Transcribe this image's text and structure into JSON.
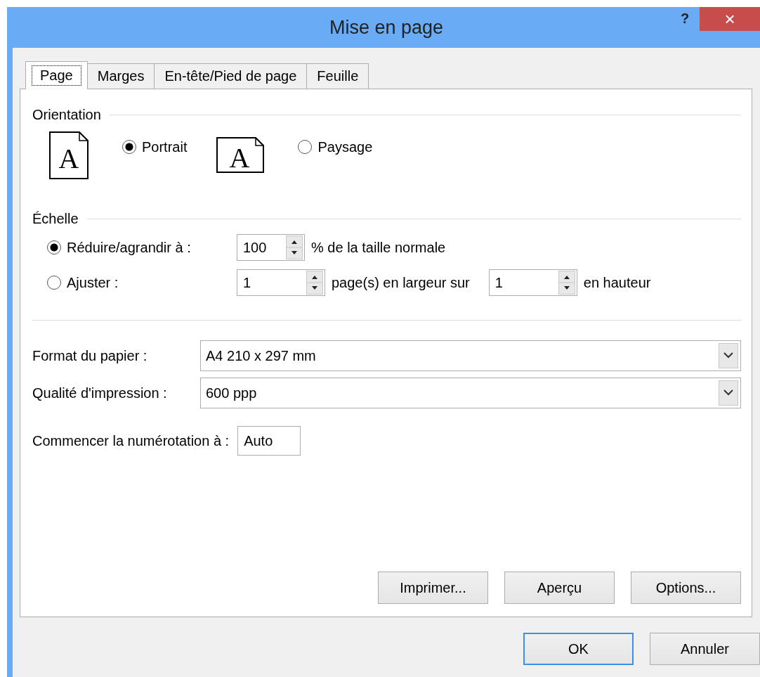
{
  "window": {
    "title": "Mise en page",
    "help": "?",
    "close": "×"
  },
  "tabs": [
    {
      "label": "Page",
      "selected": true
    },
    {
      "label": "Marges",
      "selected": false
    },
    {
      "label": "En-tête/Pied de page",
      "selected": false
    },
    {
      "label": "Feuille",
      "selected": false
    }
  ],
  "orientation": {
    "heading": "Orientation",
    "options": [
      {
        "kind": "portrait",
        "glyph": "A",
        "label": "Portrait",
        "selected": true
      },
      {
        "kind": "landscape",
        "glyph": "A",
        "label": "Paysage",
        "selected": false
      }
    ]
  },
  "scale": {
    "heading": "Échelle",
    "options": [
      {
        "label": "Réduire/agrandir à :",
        "selected": true,
        "parts": [
          {
            "kind": "spin",
            "value": "100"
          },
          {
            "kind": "text",
            "text": "% de la taille normale"
          }
        ]
      },
      {
        "label": "Ajuster :",
        "selected": false,
        "parts": [
          {
            "kind": "spin",
            "value": "1"
          },
          {
            "kind": "text",
            "text": "page(s) en largeur sur"
          },
          {
            "kind": "spin",
            "value": "1"
          },
          {
            "kind": "text",
            "text": "en hauteur"
          }
        ]
      }
    ]
  },
  "paper": [
    {
      "label": "Format du papier :",
      "value": "A4 210 x 297 mm"
    },
    {
      "label": "Qualité d'impression :",
      "value": "600 ppp"
    }
  ],
  "first_page": {
    "label": "Commencer la numérotation à :",
    "value": "Auto"
  },
  "actions": [
    "Imprimer...",
    "Aperçu",
    "Options..."
  ],
  "footer": [
    {
      "label": "OK",
      "default": true
    },
    {
      "label": "Annuler",
      "default": false
    }
  ]
}
